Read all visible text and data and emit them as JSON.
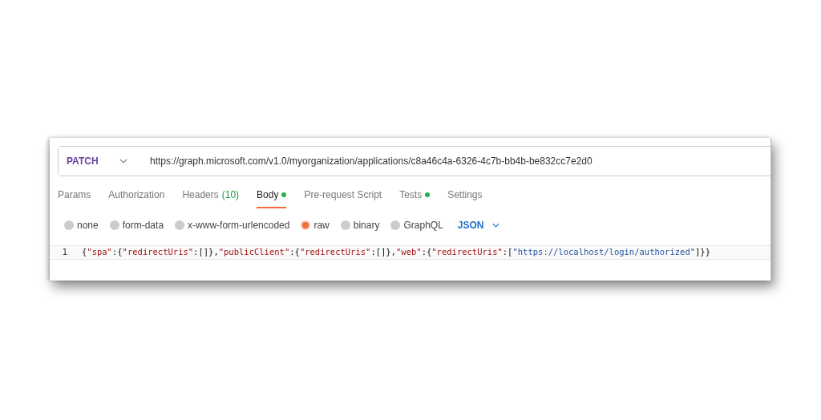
{
  "request": {
    "method": "PATCH",
    "url": "https://graph.microsoft.com/v1.0/myorganization/applications/c8a46c4a-6326-4c7b-bb4b-be832cc7e2d0"
  },
  "tabs": [
    {
      "label": "Params",
      "selected": false,
      "dot": false
    },
    {
      "label": "Authorization",
      "selected": false,
      "dot": false
    },
    {
      "label": "Headers",
      "count": "(10)",
      "selected": false,
      "dot": false
    },
    {
      "label": "Body",
      "selected": true,
      "dot": true
    },
    {
      "label": "Pre-request Script",
      "selected": false,
      "dot": false
    },
    {
      "label": "Tests",
      "selected": false,
      "dot": true
    },
    {
      "label": "Settings",
      "selected": false,
      "dot": false
    }
  ],
  "body_types": [
    {
      "label": "none",
      "selected": false
    },
    {
      "label": "form-data",
      "selected": false
    },
    {
      "label": "x-www-form-urlencoded",
      "selected": false
    },
    {
      "label": "raw",
      "selected": true
    },
    {
      "label": "binary",
      "selected": false
    },
    {
      "label": "GraphQL",
      "selected": false
    }
  ],
  "language": "JSON",
  "editor": {
    "lines": [
      {
        "number": "1",
        "tokens": [
          {
            "kind": "punct",
            "text": "{"
          },
          {
            "kind": "key",
            "text": "\"spa\""
          },
          {
            "kind": "punct",
            "text": ":{"
          },
          {
            "kind": "key",
            "text": "\"redirectUris\""
          },
          {
            "kind": "punct",
            "text": ":[]},"
          },
          {
            "kind": "key",
            "text": "\"publicClient\""
          },
          {
            "kind": "punct",
            "text": ":{"
          },
          {
            "kind": "key",
            "text": "\"redirectUris\""
          },
          {
            "kind": "punct",
            "text": ":[]},"
          },
          {
            "kind": "key",
            "text": "\"web\""
          },
          {
            "kind": "punct",
            "text": ":{"
          },
          {
            "kind": "key",
            "text": "\"redirectUris\""
          },
          {
            "kind": "punct",
            "text": ":["
          },
          {
            "kind": "string",
            "text": "\"https://localhost/login/authorized\""
          },
          {
            "kind": "punct",
            "text": "]}}"
          }
        ]
      }
    ]
  }
}
